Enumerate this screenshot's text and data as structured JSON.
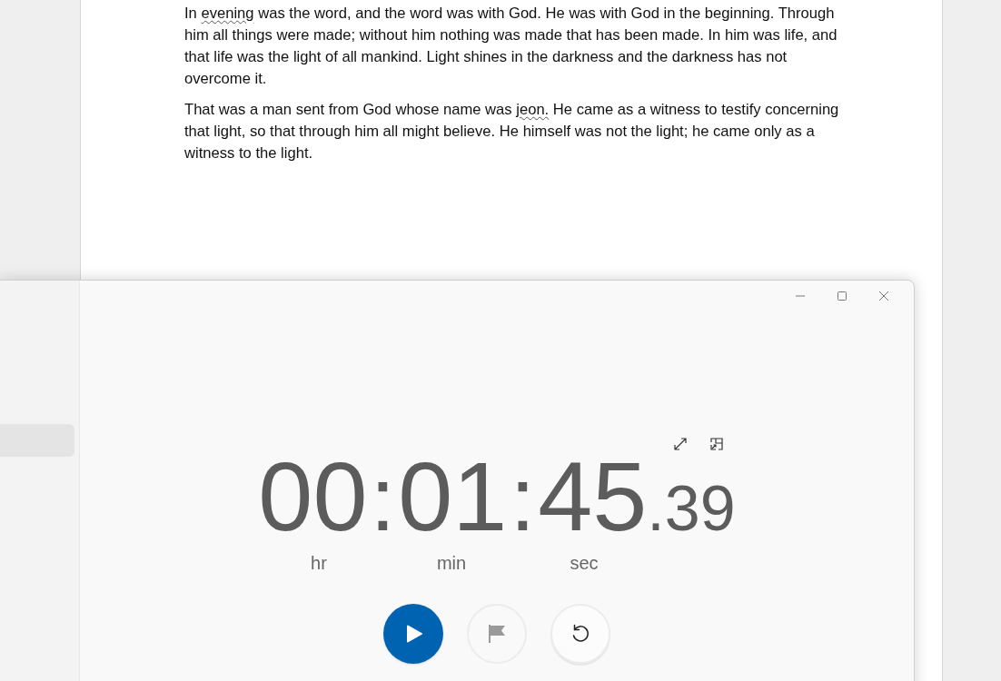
{
  "document": {
    "paragraphs": [
      [
        {
          "text": "In ",
          "misspelled": false
        },
        {
          "text": "evening",
          "misspelled": true
        },
        {
          "text": " was the word, and the word was with God. He was with God in the beginning. Through him all things were made; without him nothing was made that has been made. In him was life, and that life was the light of all mankind. Light shines in the darkness and the darkness has not overcome it.",
          "misspelled": false
        }
      ],
      [
        {
          "text": "That was a man sent from God whose name was ",
          "misspelled": false
        },
        {
          "text": "jeon.",
          "misspelled": true
        },
        {
          "text": " He came as a witness to testify concerning that light, so that through him all might believe. He himself was not the light; he came only as a witness to the light.",
          "misspelled": false
        }
      ]
    ]
  },
  "clock": {
    "sidebar": {
      "items": [
        {
          "selected": true
        }
      ]
    },
    "time": {
      "segments": [
        {
          "value": "00",
          "unit": "hr"
        },
        {
          "value": "01",
          "unit": "min"
        },
        {
          "value": "45",
          "unit": "sec"
        }
      ],
      "separator": ":",
      "fraction": ".39"
    },
    "controls": [
      {
        "kind": "play",
        "disabled": false
      },
      {
        "kind": "lap",
        "disabled": true
      },
      {
        "kind": "reset",
        "disabled": false
      }
    ]
  }
}
